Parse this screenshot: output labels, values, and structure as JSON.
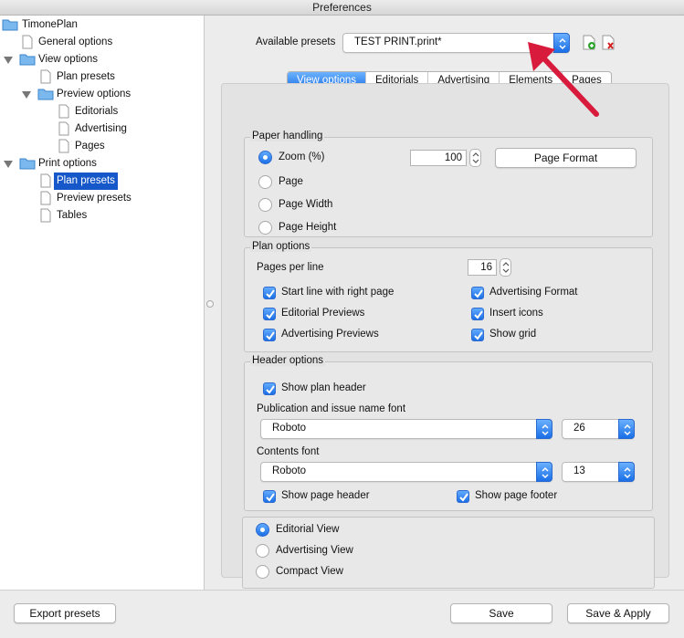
{
  "window": {
    "title": "Preferences"
  },
  "tree": [
    {
      "label": "TimonePlan",
      "type": "folder",
      "level": 0,
      "expanded": false
    },
    {
      "label": "General options",
      "type": "doc",
      "level": 1
    },
    {
      "label": "View options",
      "type": "folder",
      "level": 0,
      "expanded": true
    },
    {
      "label": "Plan presets",
      "type": "doc",
      "level": 1
    },
    {
      "label": "Preview options",
      "type": "folder",
      "level": 1,
      "expanded": true
    },
    {
      "label": "Editorials",
      "type": "doc",
      "level": 2
    },
    {
      "label": "Advertising",
      "type": "doc",
      "level": 2
    },
    {
      "label": "Pages",
      "type": "doc",
      "level": 2
    },
    {
      "label": "Print options",
      "type": "folder",
      "level": 0,
      "expanded": true
    },
    {
      "label": "Plan presets",
      "type": "doc",
      "level": 1,
      "selected": true
    },
    {
      "label": "Preview presets",
      "type": "doc",
      "level": 1
    },
    {
      "label": "Tables",
      "type": "doc",
      "level": 1
    }
  ],
  "presets": {
    "label": "Available presets",
    "value": "TEST PRINT.print*"
  },
  "tabs": [
    "View options",
    "Editorials",
    "Advertising",
    "Elements",
    "Pages"
  ],
  "paper": {
    "title": "Paper handling",
    "zoom_label": "Zoom (%)",
    "zoom_value": "100",
    "page_format_button": "Page Format",
    "page": "Page",
    "page_width": "Page Width",
    "page_height": "Page Height"
  },
  "plan": {
    "title": "Plan options",
    "pages_per_line_label": "Pages per line",
    "pages_per_line_value": "16",
    "start_line": "Start line with right page",
    "editorial_previews": "Editorial Previews",
    "advertising_previews": "Advertising Previews",
    "advertising_format": "Advertising Format",
    "insert_icons": "Insert icons",
    "show_grid": "Show grid"
  },
  "header": {
    "title": "Header options",
    "show_plan_header": "Show plan header",
    "pub_font_label": "Publication and issue name font",
    "pub_font": "Roboto",
    "pub_size": "26",
    "contents_font_label": "Contents font",
    "contents_font": "Roboto",
    "contents_size": "13",
    "show_page_header": "Show page header",
    "show_page_footer": "Show page footer"
  },
  "view": {
    "editorial": "Editorial View",
    "advertising": "Advertising View",
    "compact": "Compact View"
  },
  "buttons": {
    "export": "Export presets",
    "save": "Save",
    "save_apply": "Save & Apply"
  },
  "colors": {
    "accent": "#1b6ee5",
    "selection": "#1658c9",
    "annotation": "#d81b3c"
  }
}
